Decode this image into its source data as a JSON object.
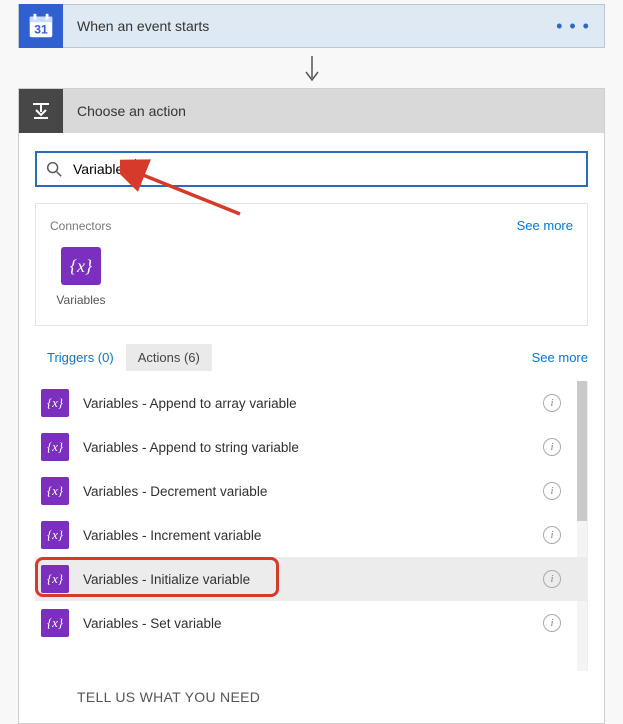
{
  "trigger": {
    "title": "When an event starts",
    "calendar_day": "31"
  },
  "actionPicker": {
    "headerTitle": "Choose an action",
    "search": {
      "value": "Variables"
    },
    "connectors": {
      "label": "Connectors",
      "seeMore": "See more",
      "items": [
        {
          "label": "Variables"
        }
      ]
    },
    "tabs": {
      "triggers": "Triggers (0)",
      "actions": "Actions (6)",
      "seeMore": "See more"
    },
    "actions": [
      {
        "label": "Variables - Append to array variable"
      },
      {
        "label": "Variables - Append to string variable"
      },
      {
        "label": "Variables - Decrement variable"
      },
      {
        "label": "Variables - Increment variable"
      },
      {
        "label": "Variables - Initialize variable"
      },
      {
        "label": "Variables - Set variable"
      }
    ],
    "footer": "TELL US WHAT YOU NEED"
  }
}
